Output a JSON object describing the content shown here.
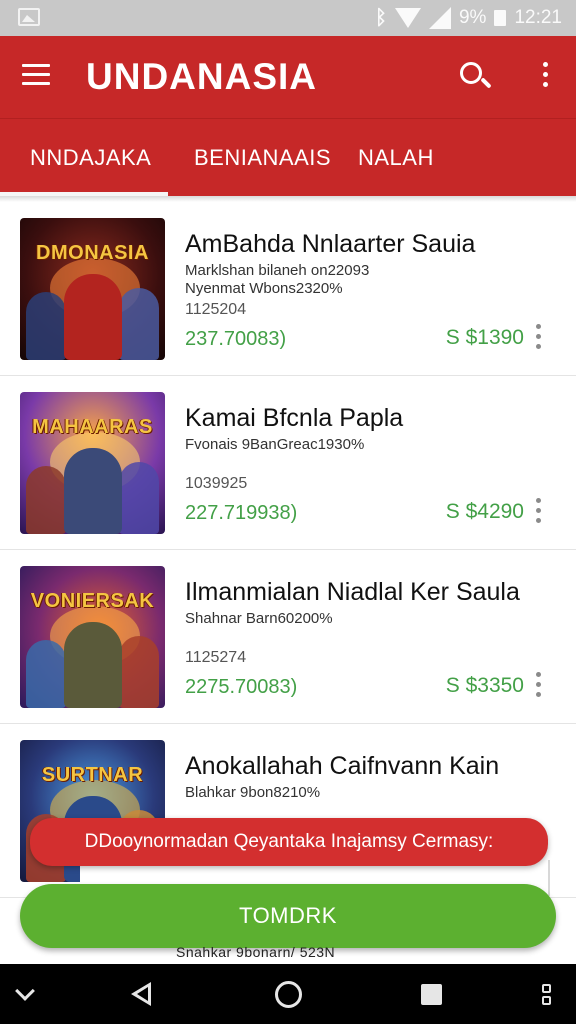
{
  "status_bar": {
    "battery_text": "9%",
    "time": "12:21"
  },
  "app_bar": {
    "title": "UNDANASIA"
  },
  "tabs": [
    {
      "label": "NNDAJAKA",
      "active": true
    },
    {
      "label": "BENIANAAIS",
      "active": false
    },
    {
      "label": "NALAH",
      "active": false
    }
  ],
  "items": [
    {
      "thumb_text": "DMONASIA",
      "title": "AmBahda Nnlaarter Sauia",
      "subtitle_1": "Marklshan bilaneh on22093",
      "subtitle_2": "Nyenmat Wbons2320%",
      "code": "1125204",
      "green_value": "237.70083)",
      "price": "S $1390"
    },
    {
      "thumb_text": "MAHAARAS",
      "title": "Kamai Bfcnla Papla",
      "subtitle_1": "Fvonais 9BanGreac1930%",
      "subtitle_2": "",
      "code": "1039925",
      "green_value": "227.719938)",
      "price": "S $4290"
    },
    {
      "thumb_text": "VONIERSAK",
      "title": "Ilmanmialan Niadlal Ker Saula",
      "subtitle_1": "Shahnar Barn60200%",
      "subtitle_2": "",
      "code": "1125274",
      "green_value": "2275.70083)",
      "price": "S $3350"
    },
    {
      "thumb_text": "SURTNAR",
      "title": "Anokallahah Caifnvann Kain",
      "subtitle_1": "Blahkar 9bon8210%",
      "subtitle_2": "",
      "code": "",
      "green_value": "",
      "price": ""
    }
  ],
  "snackbar": {
    "text": "DDooynormadan Qeyantaka Inajamsy Cermasy:"
  },
  "action_button": {
    "label": "TOMDRK"
  },
  "peek_text": "Snahkar 9bonarn/ 523N",
  "colors": {
    "primary": "#c62828",
    "accent_green": "#43a047",
    "button_green": "#5cb030",
    "snackbar_red": "#d32f2f"
  },
  "icons": {
    "menu": "hamburger-icon",
    "search": "search-icon",
    "overflow": "more-vert-icon",
    "nav_back": "back-triangle-icon",
    "nav_home": "home-circle-icon",
    "nav_recents": "recents-square-icon"
  }
}
